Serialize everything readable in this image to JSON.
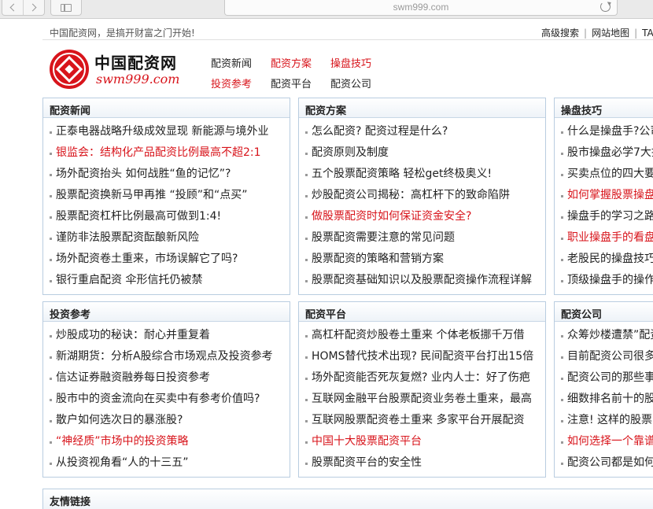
{
  "browser": {
    "url": "swm999.com"
  },
  "topbar": {
    "slogan": "中国配资网，是搞开财富之门开始!",
    "links": [
      "高级搜索",
      "网站地图",
      "TA"
    ],
    "separator": "|"
  },
  "logo": {
    "name": "中国配资网",
    "url": "swm999.com"
  },
  "nav": [
    {
      "label": "配资新闻",
      "red": false
    },
    {
      "label": "配资方案",
      "red": true
    },
    {
      "label": "操盘技巧",
      "red": true
    },
    {
      "label": "投资参考",
      "red": true
    },
    {
      "label": "配资平台",
      "red": false
    },
    {
      "label": "配资公司",
      "red": false
    }
  ],
  "panels": [
    {
      "title": "配资新闻",
      "items": [
        {
          "text": "正泰电器战略升级成效显现 新能源与境外业",
          "red": false
        },
        {
          "text": "银监会：结构化产品配资比例最高不超2:1",
          "red": true
        },
        {
          "text": "场外配资抬头 如何战胜“鱼的记忆”?",
          "red": false
        },
        {
          "text": "股票配资换新马甲再推 “投顾”和“点买”",
          "red": false
        },
        {
          "text": "股票配资杠杆比例最高可做到1:4!",
          "red": false
        },
        {
          "text": "谨防非法股票配资酝酿新风险",
          "red": false
        },
        {
          "text": "场外配资卷土重来，市场误解它了吗?",
          "red": false
        },
        {
          "text": "银行重启配资 伞形信托仍被禁",
          "red": false
        }
      ]
    },
    {
      "title": "配资方案",
      "items": [
        {
          "text": "怎么配资? 配资过程是什么?",
          "red": false
        },
        {
          "text": "配资原则及制度",
          "red": false
        },
        {
          "text": "五个股票配资策略 轻松get终极奥义!",
          "red": false
        },
        {
          "text": "炒股配资公司揭秘：高杠杆下的致命陷阱",
          "red": false
        },
        {
          "text": "做股票配资时如何保证资金安全?",
          "red": true
        },
        {
          "text": "股票配资需要注意的常见问题",
          "red": false
        },
        {
          "text": "股票配资的策略和营销方案",
          "red": false
        },
        {
          "text": "股票配资基础知识以及股票配资操作流程详解",
          "red": false
        }
      ]
    },
    {
      "title": "操盘技巧",
      "items": [
        {
          "text": "什么是操盘手?公司",
          "red": false
        },
        {
          "text": "股市操盘必学7大技",
          "red": false
        },
        {
          "text": "买卖点位的四大要",
          "red": false
        },
        {
          "text": "如何掌握股票操盘",
          "red": true
        },
        {
          "text": "操盘手的学习之路",
          "red": false
        },
        {
          "text": "职业操盘手的看盘",
          "red": true
        },
        {
          "text": "老股民的操盘技巧",
          "red": false
        },
        {
          "text": "顶级操盘手的操作",
          "red": false
        }
      ]
    },
    {
      "title": "投资参考",
      "items": [
        {
          "text": "炒股成功的秘诀：耐心并重复着",
          "red": false
        },
        {
          "text": "新湖期货：分析A股综合市场观点及投资参考",
          "red": false
        },
        {
          "text": "信达证券融资融券每日投资参考",
          "red": false
        },
        {
          "text": "股市中的资金流向在买卖中有参考价值吗?",
          "red": false
        },
        {
          "text": "散户如何选次日的暴涨股?",
          "red": false
        },
        {
          "text": "“神经质”市场中的投资策略",
          "red": true
        },
        {
          "text": "从投资视角看“人的十三五”",
          "red": false
        }
      ]
    },
    {
      "title": "配资平台",
      "items": [
        {
          "text": "高杠杆配资炒股卷土重来 个体老板挪千万借",
          "red": false
        },
        {
          "text": "HOMS替代技术出现? 民间配资平台打出15倍",
          "red": false
        },
        {
          "text": "场外配资能否死灰复燃? 业内人士：好了伤疤",
          "red": false
        },
        {
          "text": "互联网金融平台股票配资业务卷土重来，最高",
          "red": false
        },
        {
          "text": "互联网股票配资卷土重来 多家平台开展配资",
          "red": false
        },
        {
          "text": "中国十大股票配资平台",
          "red": true
        },
        {
          "text": "股票配资平台的安全性",
          "red": false
        }
      ]
    },
    {
      "title": "配资公司",
      "items": [
        {
          "text": "众筹炒楼遭禁”配资",
          "red": false
        },
        {
          "text": "目前配资公司很多",
          "red": false
        },
        {
          "text": "配资公司的那些事",
          "red": false
        },
        {
          "text": "细数排名前十的股",
          "red": false
        },
        {
          "text": "注意! 这样的股票",
          "red": false
        },
        {
          "text": "如何选择一个靠谱",
          "red": true
        },
        {
          "text": "配资公司都是如何",
          "red": false
        }
      ]
    }
  ],
  "friend_links": {
    "title": "友情链接"
  },
  "colors": {
    "accent_red": "#d8141b",
    "panel_border": "#b9cde0"
  }
}
